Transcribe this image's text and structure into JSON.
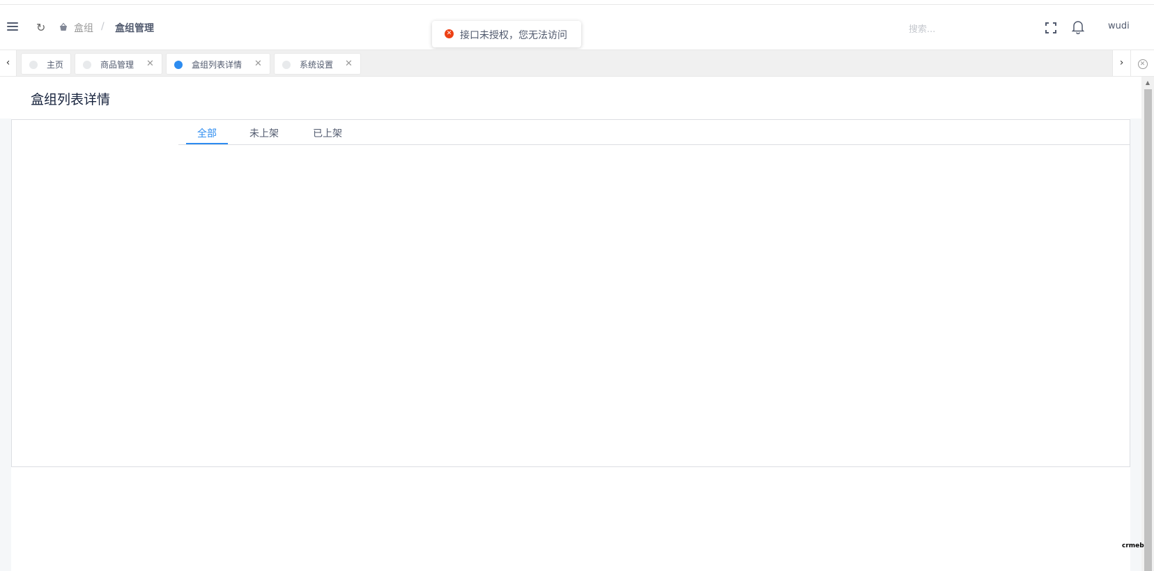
{
  "header": {
    "breadcrumb": [
      "盒组",
      "盒组管理"
    ],
    "breadcrumb_separator": "/",
    "search_placeholder": "搜索...",
    "user_name": "wudi"
  },
  "toast": {
    "type": "error",
    "message": "接口未授权，您无法访问"
  },
  "tabbar": {
    "tabs": [
      {
        "label": "主页",
        "closable": false,
        "active": false
      },
      {
        "label": "商品管理",
        "closable": true,
        "active": false
      },
      {
        "label": "盒组列表详情",
        "closable": true,
        "active": true
      },
      {
        "label": "系统设置",
        "closable": true,
        "active": false
      }
    ]
  },
  "page": {
    "title": "盒组列表详情",
    "content_tabs": [
      {
        "label": "全部",
        "active": true
      },
      {
        "label": "未上架",
        "active": false
      },
      {
        "label": "已上架",
        "active": false
      }
    ]
  },
  "footer_logo": "crmeb",
  "colors": {
    "accent": "#2d8cf0",
    "error": "#ed4014",
    "text": "#515a6e",
    "border": "#dcdee2"
  },
  "icons": [
    "menu-icon",
    "refresh-icon",
    "basket-icon",
    "fullscreen-icon",
    "bell-icon",
    "chevron-left-icon",
    "chevron-right-icon",
    "close-circle-icon"
  ]
}
